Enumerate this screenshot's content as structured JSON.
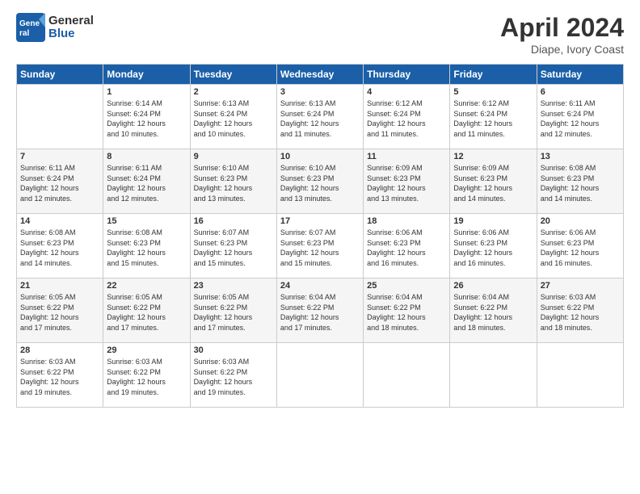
{
  "logo": {
    "general": "General",
    "blue": "Blue"
  },
  "header": {
    "month": "April 2024",
    "location": "Diape, Ivory Coast"
  },
  "weekdays": [
    "Sunday",
    "Monday",
    "Tuesday",
    "Wednesday",
    "Thursday",
    "Friday",
    "Saturday"
  ],
  "weeks": [
    [
      {
        "day": null,
        "info": null
      },
      {
        "day": "1",
        "info": "Sunrise: 6:14 AM\nSunset: 6:24 PM\nDaylight: 12 hours\nand 10 minutes."
      },
      {
        "day": "2",
        "info": "Sunrise: 6:13 AM\nSunset: 6:24 PM\nDaylight: 12 hours\nand 10 minutes."
      },
      {
        "day": "3",
        "info": "Sunrise: 6:13 AM\nSunset: 6:24 PM\nDaylight: 12 hours\nand 11 minutes."
      },
      {
        "day": "4",
        "info": "Sunrise: 6:12 AM\nSunset: 6:24 PM\nDaylight: 12 hours\nand 11 minutes."
      },
      {
        "day": "5",
        "info": "Sunrise: 6:12 AM\nSunset: 6:24 PM\nDaylight: 12 hours\nand 11 minutes."
      },
      {
        "day": "6",
        "info": "Sunrise: 6:11 AM\nSunset: 6:24 PM\nDaylight: 12 hours\nand 12 minutes."
      }
    ],
    [
      {
        "day": "7",
        "info": "Sunrise: 6:11 AM\nSunset: 6:24 PM\nDaylight: 12 hours\nand 12 minutes."
      },
      {
        "day": "8",
        "info": "Sunrise: 6:11 AM\nSunset: 6:24 PM\nDaylight: 12 hours\nand 12 minutes."
      },
      {
        "day": "9",
        "info": "Sunrise: 6:10 AM\nSunset: 6:23 PM\nDaylight: 12 hours\nand 13 minutes."
      },
      {
        "day": "10",
        "info": "Sunrise: 6:10 AM\nSunset: 6:23 PM\nDaylight: 12 hours\nand 13 minutes."
      },
      {
        "day": "11",
        "info": "Sunrise: 6:09 AM\nSunset: 6:23 PM\nDaylight: 12 hours\nand 13 minutes."
      },
      {
        "day": "12",
        "info": "Sunrise: 6:09 AM\nSunset: 6:23 PM\nDaylight: 12 hours\nand 14 minutes."
      },
      {
        "day": "13",
        "info": "Sunrise: 6:08 AM\nSunset: 6:23 PM\nDaylight: 12 hours\nand 14 minutes."
      }
    ],
    [
      {
        "day": "14",
        "info": "Sunrise: 6:08 AM\nSunset: 6:23 PM\nDaylight: 12 hours\nand 14 minutes."
      },
      {
        "day": "15",
        "info": "Sunrise: 6:08 AM\nSunset: 6:23 PM\nDaylight: 12 hours\nand 15 minutes."
      },
      {
        "day": "16",
        "info": "Sunrise: 6:07 AM\nSunset: 6:23 PM\nDaylight: 12 hours\nand 15 minutes."
      },
      {
        "day": "17",
        "info": "Sunrise: 6:07 AM\nSunset: 6:23 PM\nDaylight: 12 hours\nand 15 minutes."
      },
      {
        "day": "18",
        "info": "Sunrise: 6:06 AM\nSunset: 6:23 PM\nDaylight: 12 hours\nand 16 minutes."
      },
      {
        "day": "19",
        "info": "Sunrise: 6:06 AM\nSunset: 6:23 PM\nDaylight: 12 hours\nand 16 minutes."
      },
      {
        "day": "20",
        "info": "Sunrise: 6:06 AM\nSunset: 6:23 PM\nDaylight: 12 hours\nand 16 minutes."
      }
    ],
    [
      {
        "day": "21",
        "info": "Sunrise: 6:05 AM\nSunset: 6:22 PM\nDaylight: 12 hours\nand 17 minutes."
      },
      {
        "day": "22",
        "info": "Sunrise: 6:05 AM\nSunset: 6:22 PM\nDaylight: 12 hours\nand 17 minutes."
      },
      {
        "day": "23",
        "info": "Sunrise: 6:05 AM\nSunset: 6:22 PM\nDaylight: 12 hours\nand 17 minutes."
      },
      {
        "day": "24",
        "info": "Sunrise: 6:04 AM\nSunset: 6:22 PM\nDaylight: 12 hours\nand 17 minutes."
      },
      {
        "day": "25",
        "info": "Sunrise: 6:04 AM\nSunset: 6:22 PM\nDaylight: 12 hours\nand 18 minutes."
      },
      {
        "day": "26",
        "info": "Sunrise: 6:04 AM\nSunset: 6:22 PM\nDaylight: 12 hours\nand 18 minutes."
      },
      {
        "day": "27",
        "info": "Sunrise: 6:03 AM\nSunset: 6:22 PM\nDaylight: 12 hours\nand 18 minutes."
      }
    ],
    [
      {
        "day": "28",
        "info": "Sunrise: 6:03 AM\nSunset: 6:22 PM\nDaylight: 12 hours\nand 19 minutes."
      },
      {
        "day": "29",
        "info": "Sunrise: 6:03 AM\nSunset: 6:22 PM\nDaylight: 12 hours\nand 19 minutes."
      },
      {
        "day": "30",
        "info": "Sunrise: 6:03 AM\nSunset: 6:22 PM\nDaylight: 12 hours\nand 19 minutes."
      },
      {
        "day": null,
        "info": null
      },
      {
        "day": null,
        "info": null
      },
      {
        "day": null,
        "info": null
      },
      {
        "day": null,
        "info": null
      }
    ]
  ]
}
